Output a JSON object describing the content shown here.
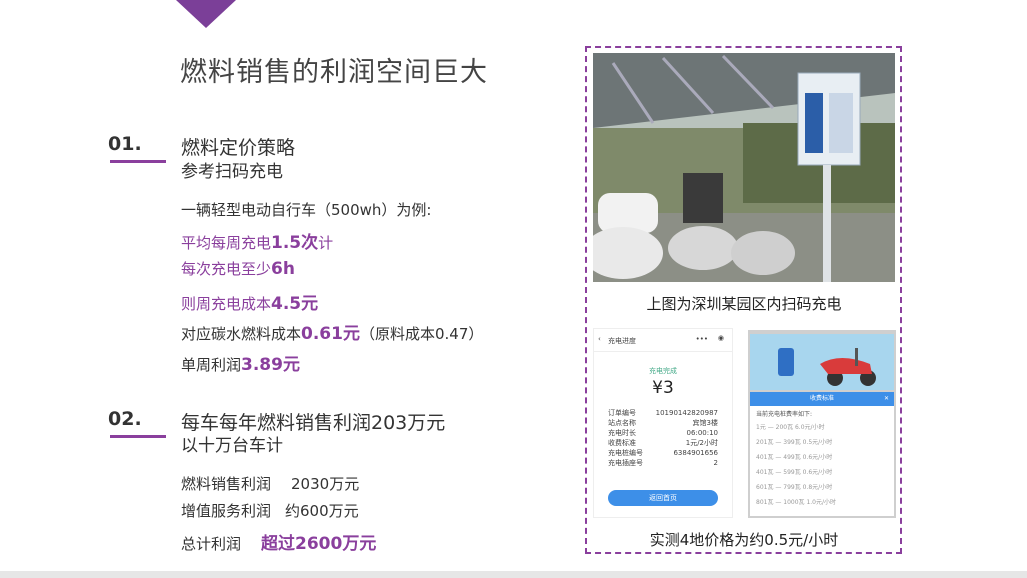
{
  "title": "燃料销售的利润空间巨大",
  "section1": {
    "number": "01.",
    "heading": "燃料定价策略",
    "subheading": "参考扫码充电",
    "intro": "一辆轻型电动自行车（500wh）为例:",
    "lines": [
      {
        "prefix": "平均每周充电",
        "value": "1.5次",
        "suffix": "计"
      },
      {
        "prefix": "每次充电至少",
        "value": "6h",
        "suffix": ""
      },
      {
        "prefix": "则周充电成本",
        "value": "4.5元",
        "suffix": ""
      },
      {
        "prefix": "对应碳水燃料成本",
        "value": "0.61元",
        "suffix": "（原料成本0.47）"
      },
      {
        "prefix": "单周利润",
        "value": "3.89元",
        "suffix": ""
      }
    ]
  },
  "section2": {
    "number": "02.",
    "heading": "每车每年燃料销售利润203万元",
    "subheading": "以十万台车计",
    "rows": [
      {
        "label": "燃料销售利润",
        "value": "2030万元"
      },
      {
        "label": "增值服务利润",
        "value": "约600万元"
      },
      {
        "label": "总计利润",
        "value": "超过2600万元"
      }
    ]
  },
  "photo_caption": "上图为深圳某园区内扫码充电",
  "bottom_caption": "实测4地价格为约0.5元/小时",
  "phone1": {
    "header": "充电进度",
    "status": "充电完成",
    "amount": "¥3",
    "details": [
      [
        "订单编号",
        "10190142820987"
      ],
      [
        "站点名称",
        "宾馆3楼"
      ],
      [
        "充电时长",
        "06:00:10"
      ],
      [
        "收费标准",
        "1元/2小时"
      ],
      [
        "充电桩编号",
        "6384901656"
      ],
      [
        "充电插座号",
        "2"
      ]
    ],
    "button": "返回首页"
  },
  "phone2": {
    "dialog_title": "收费标准",
    "dialog_intro": "当前充电桩费率如下:",
    "rates": [
      "1元 — 200瓦 6.0元/小时",
      "201瓦 — 399瓦 0.5元/小时",
      "401瓦 — 499瓦 0.6元/小时",
      "401瓦 — 599瓦 0.6元/小时",
      "601瓦 — 799瓦 0.8元/小时",
      "801瓦 — 1000瓦 1.0元/小时"
    ]
  },
  "colors": {
    "accent": "#8a3f9d",
    "text": "#333333"
  }
}
